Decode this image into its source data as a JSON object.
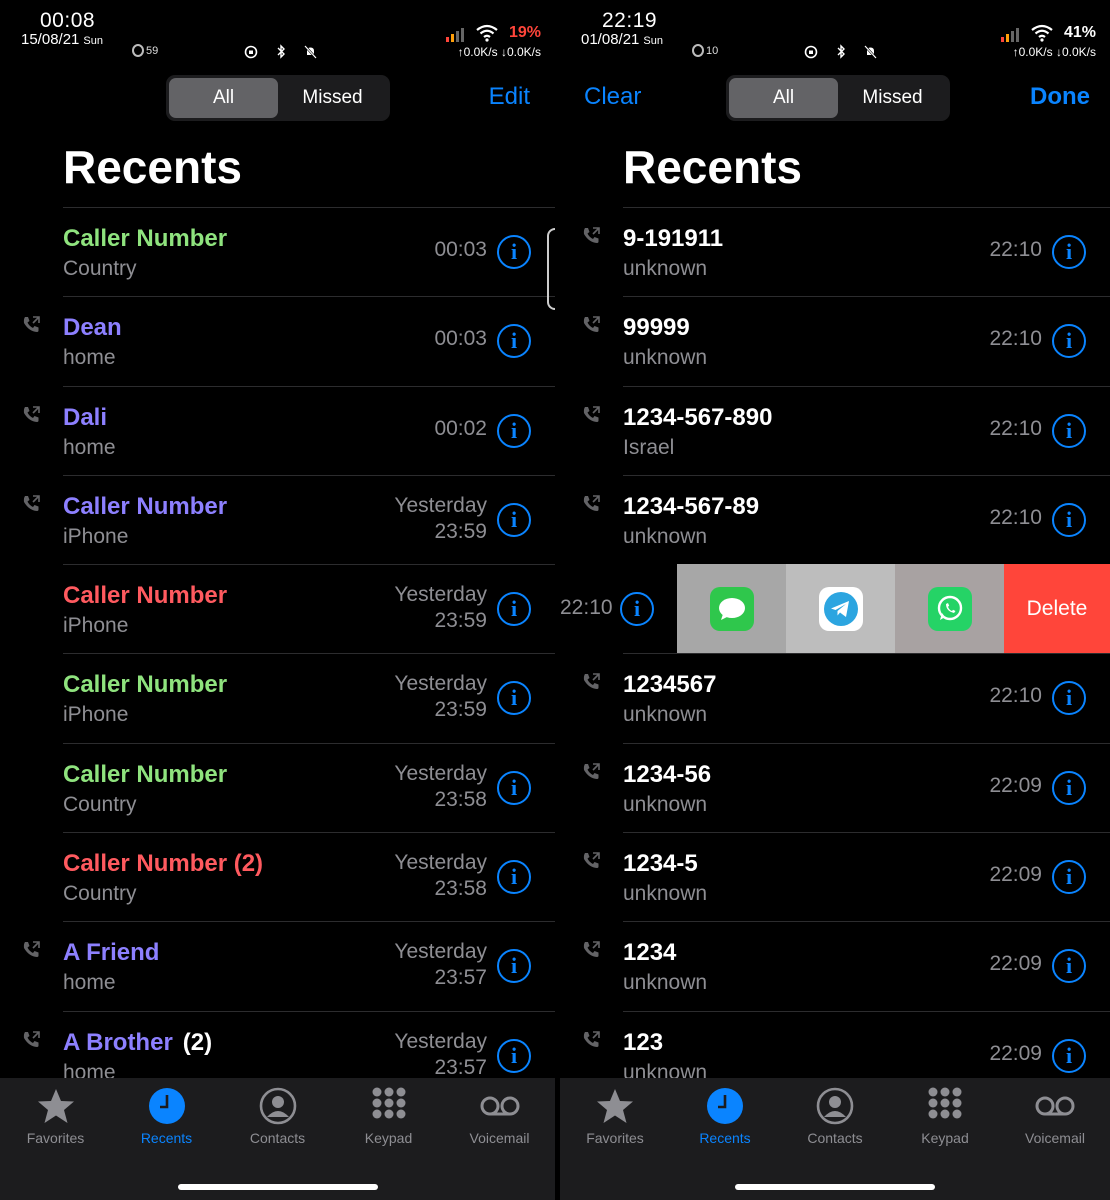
{
  "colors": {
    "accent": "#0a84ff",
    "green": "#8fe37e",
    "purple": "#8d80ff",
    "red": "#ff5a5f",
    "delete_red": "#ff453a",
    "battery_low": "#ff453a"
  },
  "left": {
    "status": {
      "time": "00:08",
      "date": "15/08/21",
      "day": "Sun",
      "ring_count": "59",
      "battery": "19%",
      "net": "↑0.0K/s ↓0.0K/s"
    },
    "segment": {
      "all": "All",
      "missed": "Missed"
    },
    "edit_label": "Edit",
    "title": "Recents",
    "rows": [
      {
        "name": "Caller Number",
        "count": "",
        "sub": "Country",
        "time1": "00:03",
        "time2": "",
        "color": "#8fe37e",
        "icon": false
      },
      {
        "name": "Dean",
        "count": "",
        "sub": "home",
        "time1": "00:03",
        "time2": "",
        "color": "#8d80ff",
        "icon": true
      },
      {
        "name": "Dali",
        "count": "",
        "sub": "home",
        "time1": "00:02",
        "time2": "",
        "color": "#8d80ff",
        "icon": true
      },
      {
        "name": "Caller Number",
        "count": "",
        "sub": "iPhone",
        "time1": "Yesterday",
        "time2": "23:59",
        "color": "#8d80ff",
        "icon": true
      },
      {
        "name": "Caller Number",
        "count": "",
        "sub": "iPhone",
        "time1": "Yesterday",
        "time2": "23:59",
        "color": "#ff5a5f",
        "icon": false
      },
      {
        "name": "Caller Number",
        "count": "",
        "sub": "iPhone",
        "time1": "Yesterday",
        "time2": "23:59",
        "color": "#8fe37e",
        "icon": false
      },
      {
        "name": "Caller Number",
        "count": "",
        "sub": "Country",
        "time1": "Yesterday",
        "time2": "23:58",
        "color": "#8fe37e",
        "icon": false
      },
      {
        "name": "Caller Number (2)",
        "count": "",
        "sub": "Country",
        "time1": "Yesterday",
        "time2": "23:58",
        "color": "#ff5a5f",
        "icon": false
      },
      {
        "name": "A Friend",
        "count": "",
        "sub": "home",
        "time1": "Yesterday",
        "time2": "23:57",
        "color": "#8d80ff",
        "icon": true
      },
      {
        "name": "A Brother",
        "count": "(2)",
        "sub": "home",
        "time1": "Yesterday",
        "time2": "23:57",
        "color": "#8d80ff",
        "icon": true
      }
    ]
  },
  "right": {
    "status": {
      "time": "22:19",
      "date": "01/08/21",
      "day": "Sun",
      "ring_count": "10",
      "battery": "41%",
      "net": "↑0.0K/s ↓0.0K/s"
    },
    "segment": {
      "all": "All",
      "missed": "Missed"
    },
    "clear_label": "Clear",
    "done_label": "Done",
    "title": "Recents",
    "rows_before": [
      {
        "name": "9-191911",
        "sub": "unknown",
        "time": "22:10"
      },
      {
        "name": "99999",
        "sub": "unknown",
        "time": "22:10"
      },
      {
        "name": "1234-567-890",
        "sub": "Israel",
        "time": "22:10"
      },
      {
        "name": "1234-567-89",
        "sub": "unknown",
        "time": "22:10"
      }
    ],
    "swipe": {
      "time": "22:10",
      "delete_label": "Delete"
    },
    "rows_after": [
      {
        "name": "1234567",
        "sub": "unknown",
        "time": "22:10"
      },
      {
        "name": "1234-56",
        "sub": "unknown",
        "time": "22:09"
      },
      {
        "name": "1234-5",
        "sub": "unknown",
        "time": "22:09"
      },
      {
        "name": "1234",
        "sub": "unknown",
        "time": "22:09"
      },
      {
        "name": "123",
        "sub": "unknown",
        "time": "22:09"
      }
    ]
  },
  "tabs": [
    {
      "label": "Favorites",
      "icon": "star-icon",
      "active": false
    },
    {
      "label": "Recents",
      "icon": "clock-icon",
      "active": true
    },
    {
      "label": "Contacts",
      "icon": "person-circle-icon",
      "active": false
    },
    {
      "label": "Keypad",
      "icon": "keypad-icon",
      "active": false
    },
    {
      "label": "Voicemail",
      "icon": "voicemail-icon",
      "active": false
    }
  ]
}
